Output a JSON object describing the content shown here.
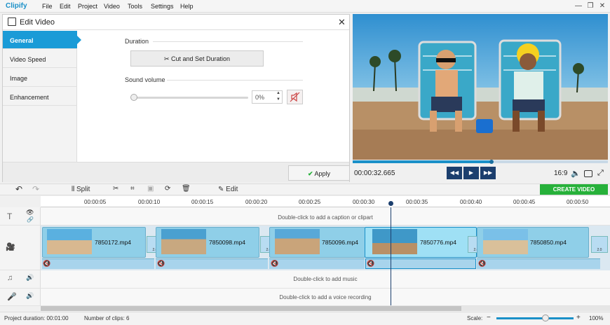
{
  "app": {
    "logo": "Clipify"
  },
  "menu": [
    "File",
    "Edit",
    "Project",
    "Video",
    "Tools",
    "Settings",
    "Help"
  ],
  "window_controls": {
    "minimize": "—",
    "restore": "❐",
    "close": "✕"
  },
  "edit_panel": {
    "title": "Edit Video",
    "close": "✕",
    "tabs": [
      "General",
      "Video Speed",
      "Image",
      "Enhancement"
    ],
    "active_tab": "General",
    "duration": {
      "label": "Duration",
      "button": "Cut and Set Duration"
    },
    "sound": {
      "label": "Sound volume",
      "value": "0%",
      "level": 0
    },
    "apply_label": "Apply"
  },
  "preview": {
    "timecode": "00:00:32.665",
    "ratio": "16:9",
    "progress": 0.545
  },
  "toolbar": {
    "split": "Split",
    "edit": "Edit",
    "create": "CREATE VIDEO"
  },
  "ruler": [
    "00:00:05",
    "00:00:10",
    "00:00:15",
    "00:00:20",
    "00:00:25",
    "00:00:30",
    "00:00:35",
    "00:00:40",
    "00:00:45",
    "00:00:50"
  ],
  "tracks": {
    "caption_hint": "Double-click to add a caption or clipart",
    "music_hint": "Double-click to add music",
    "voice_hint": "Double-click to add a voice recording"
  },
  "clips": [
    {
      "name": "7850172.mp4"
    },
    {
      "name": "7850098.mp4"
    },
    {
      "name": "7850096.mp4"
    },
    {
      "name": "7850776.mp4"
    },
    {
      "name": "7850850.mp4"
    }
  ],
  "transition_label": "2.0",
  "status": {
    "duration": "Project duration: 00:01:00",
    "clips": "Number of clips: 6",
    "scale_label": "Scale:",
    "scale_value": "100%",
    "minus": "−",
    "plus": "+"
  }
}
